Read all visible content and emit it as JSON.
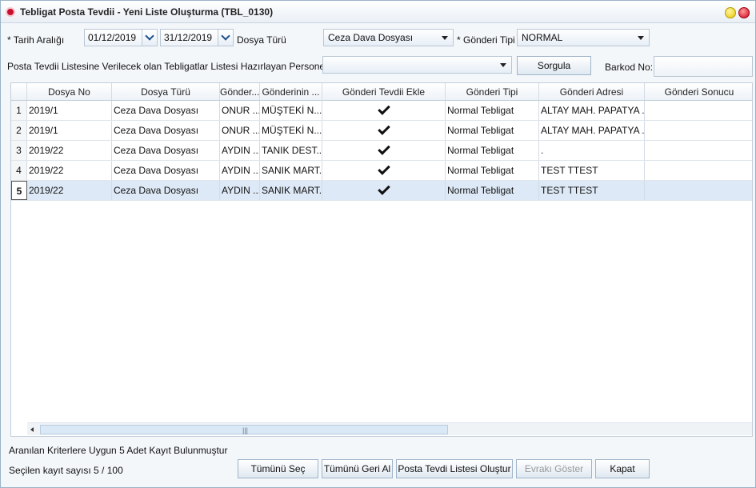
{
  "window": {
    "title": "Tebligat Posta Tevdii - Yeni Liste Oluşturma (TBL_0130)"
  },
  "filters": {
    "date_range_label": "* Tarih Aralığı",
    "date_from": "01/12/2019",
    "date_to": "31/12/2019",
    "file_type_label": "Dosya Türü",
    "file_type_value": "Ceza Dava Dosyası",
    "send_type_label": "* Gönderi Tipi",
    "send_type_value": "NORMAL",
    "personnel_label": "Posta Tevdii Listesine Verilecek olan Tebligatlar Listesi Hazırlayan Personel",
    "personnel_value": "",
    "query_button": "Sorgula",
    "barcode_label": "Barkod No:",
    "barcode_value": ""
  },
  "table": {
    "columns": [
      "Dosya No",
      "Dosya Türü",
      "Gönder...",
      "Gönderinin ...",
      "Gönderi Tevdii Ekle",
      "Gönderi Tipi",
      "Gönderi Adresi",
      "Gönderi Sonucu"
    ],
    "rows": [
      {
        "num": "1",
        "dosya_no": "2019/1",
        "dosya_turu": "Ceza Dava Dosyası",
        "gonderen": "ONUR ...",
        "gonderinin": "MÜŞTEKİ N...",
        "checked": true,
        "tip": "Normal Tebligat",
        "adres": "ALTAY MAH. PAPATYA ...",
        "sonuc": ""
      },
      {
        "num": "2",
        "dosya_no": "2019/1",
        "dosya_turu": "Ceza Dava Dosyası",
        "gonderen": "ONUR ...",
        "gonderinin": "MÜŞTEKİ N...",
        "checked": true,
        "tip": "Normal Tebligat",
        "adres": "ALTAY MAH. PAPATYA ...",
        "sonuc": ""
      },
      {
        "num": "3",
        "dosya_no": "2019/22",
        "dosya_turu": "Ceza Dava Dosyası",
        "gonderen": "AYDIN ...",
        "gonderinin": "TANIK DEST...",
        "checked": true,
        "tip": "Normal Tebligat",
        "adres": ".",
        "sonuc": ""
      },
      {
        "num": "4",
        "dosya_no": "2019/22",
        "dosya_turu": "Ceza Dava Dosyası",
        "gonderen": "AYDIN ...",
        "gonderinin": "SANIK MART...",
        "checked": true,
        "tip": "Normal Tebligat",
        "adres": "TEST TTEST",
        "sonuc": ""
      },
      {
        "num": "5",
        "dosya_no": "2019/22",
        "dosya_turu": "Ceza Dava Dosyası",
        "gonderen": "AYDIN ...",
        "gonderinin": "SANIK MART...",
        "checked": true,
        "tip": "Normal Tebligat",
        "adres": "TEST TTEST",
        "sonuc": ""
      }
    ],
    "selected_row": 4
  },
  "footer": {
    "result_text": "Aranılan Kriterlere Uygun 5 Adet Kayıt Bulunmuştur",
    "selected_count_text": "Seçilen kayıt sayısı 5 / 100",
    "buttons": {
      "select_all": "Tümünü Seç",
      "undo_all": "Tümünü Geri Al",
      "create_list": "Posta Tevdi Listesi Oluştur",
      "show_document": "Evrakı Göster",
      "close": "Kapat"
    }
  },
  "colors": {
    "selected_row": "#dde9f6",
    "window_border": "#9ab3c8"
  }
}
